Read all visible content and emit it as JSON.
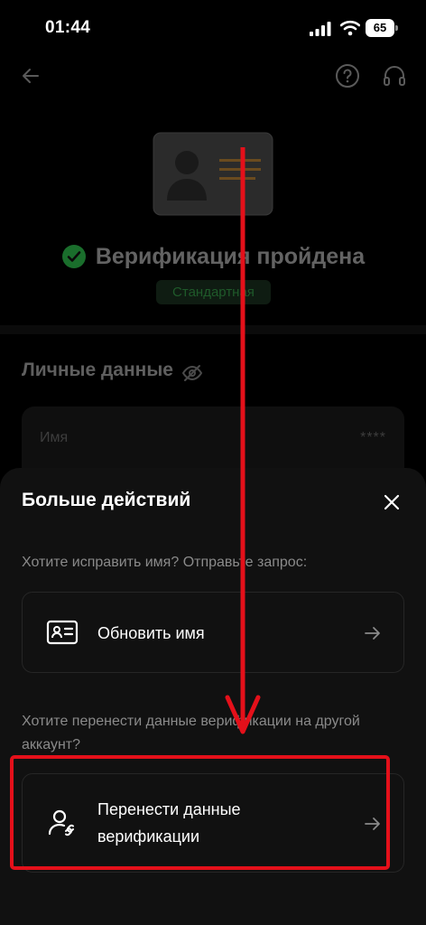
{
  "status_bar": {
    "time": "01:44",
    "battery": "65"
  },
  "background_page": {
    "verification_title": "Верификация пройдена",
    "level_badge": "Стандартная",
    "personal_section_title": "Личные данные",
    "name_field": {
      "label": "Имя",
      "value": "****"
    }
  },
  "sheet": {
    "title": "Больше действий",
    "hint_update_name": "Хотите исправить имя? Отправьте запрос:",
    "update_name_label": "Обновить имя",
    "hint_transfer": "Хотите перенести данные верификации на другой аккаунт?",
    "transfer_label": "Перенести данные верификации"
  },
  "icons": {
    "back": "back-arrow-icon",
    "help": "help-icon",
    "support": "headset-icon",
    "check": "check-circle-icon",
    "eye_off": "eye-off-icon",
    "close": "close-icon",
    "id_card": "id-card-icon",
    "user_link": "user-link-icon",
    "arrow_right": "arrow-right-icon"
  },
  "colors": {
    "sheet_bg": "#111111",
    "accent_green": "#1f9d3a",
    "annotation_red": "#e4101a"
  }
}
